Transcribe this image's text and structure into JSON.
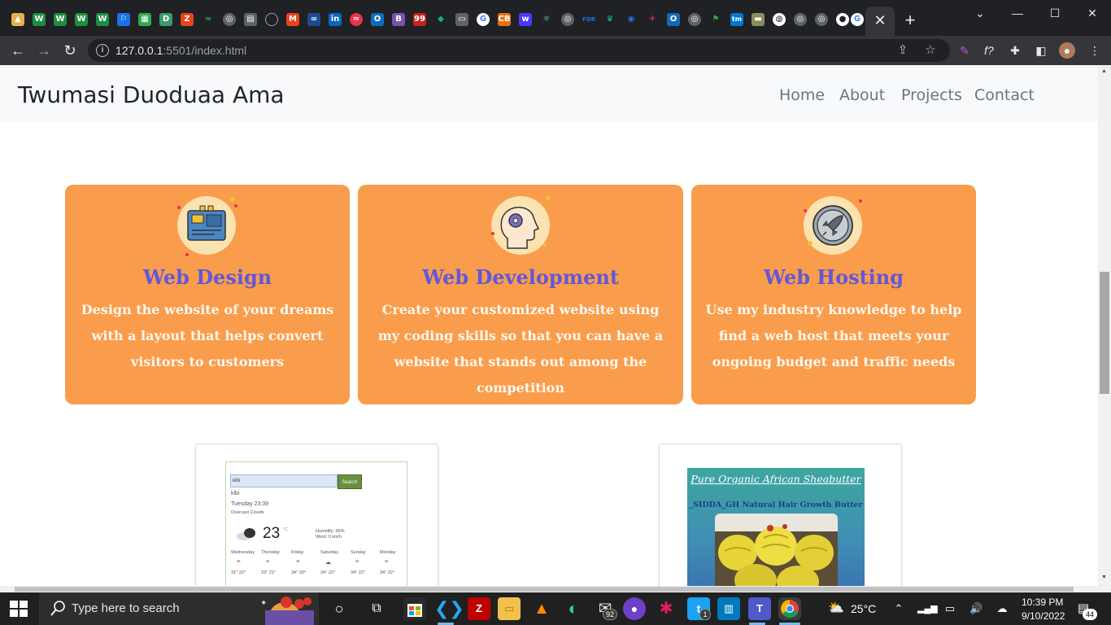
{
  "browser": {
    "tabs": [
      {
        "icon": "tab-favicon-1",
        "color": "#e8b04a"
      },
      {
        "icon": "tab-favicon-2",
        "color": "#1e8e3e"
      },
      {
        "icon": "tab-favicon-3",
        "color": "#1e8e3e"
      },
      {
        "icon": "tab-favicon-4",
        "color": "#1e8e3e"
      }
    ],
    "active_tab_close": "✕",
    "new_tab": "+",
    "window_controls": {
      "minimize": "—",
      "maximize": "☐",
      "close": "✕"
    },
    "url": {
      "host": "127.0.0.1",
      "path": ":5501/index.html"
    }
  },
  "site": {
    "brand": "Twumasi Duoduaa Ama",
    "nav": [
      "Home",
      "About",
      "Projects",
      "Contact"
    ],
    "services": [
      {
        "title": "Web Design",
        "description": "Design the website of your dreams with a layout that helps convert visitors to customers",
        "icon": "circuit-board-icon"
      },
      {
        "title": "Web Development",
        "description": "Create your customized website using my coding skills so that you can have a website that stands out among the competition",
        "icon": "head-gear-icon"
      },
      {
        "title": "Web Hosting",
        "description": "Use my industry knowledge to help find a web host that meets your ongoing budget and traffic needs",
        "icon": "rocket-icon"
      }
    ],
    "projects": {
      "weather": {
        "search_value": "kibi",
        "search_button": "Search",
        "city": "kibi",
        "datetime": "Tuesday 23:39",
        "condition": "Overcast Clouds",
        "temperature": "23",
        "unit": "°C",
        "humidity": "Humidity: 95%",
        "wind": "Wind: 0 km/h",
        "forecast": [
          {
            "day": "Wednesday",
            "temps": "31° 22°"
          },
          {
            "day": "Thursday",
            "temps": "23° 21°"
          },
          {
            "day": "Friday",
            "temps": "34° 20°"
          },
          {
            "day": "Saturday",
            "temps": "34° 22°"
          },
          {
            "day": "Sunday",
            "temps": "34° 22°"
          },
          {
            "day": "Monday",
            "temps": "34° 22°"
          }
        ]
      },
      "shea": {
        "title": "Pure Organic African Sheabutter",
        "subtitle": "_SIDDA_GH Natural Hair Growth Butter"
      }
    }
  },
  "taskbar": {
    "search_placeholder": "Type here to search",
    "weather": "25°C",
    "time": "10:39 PM",
    "date": "9/10/2022",
    "badges": {
      "mail": "92",
      "twitter": "1",
      "notifications": "44"
    }
  }
}
